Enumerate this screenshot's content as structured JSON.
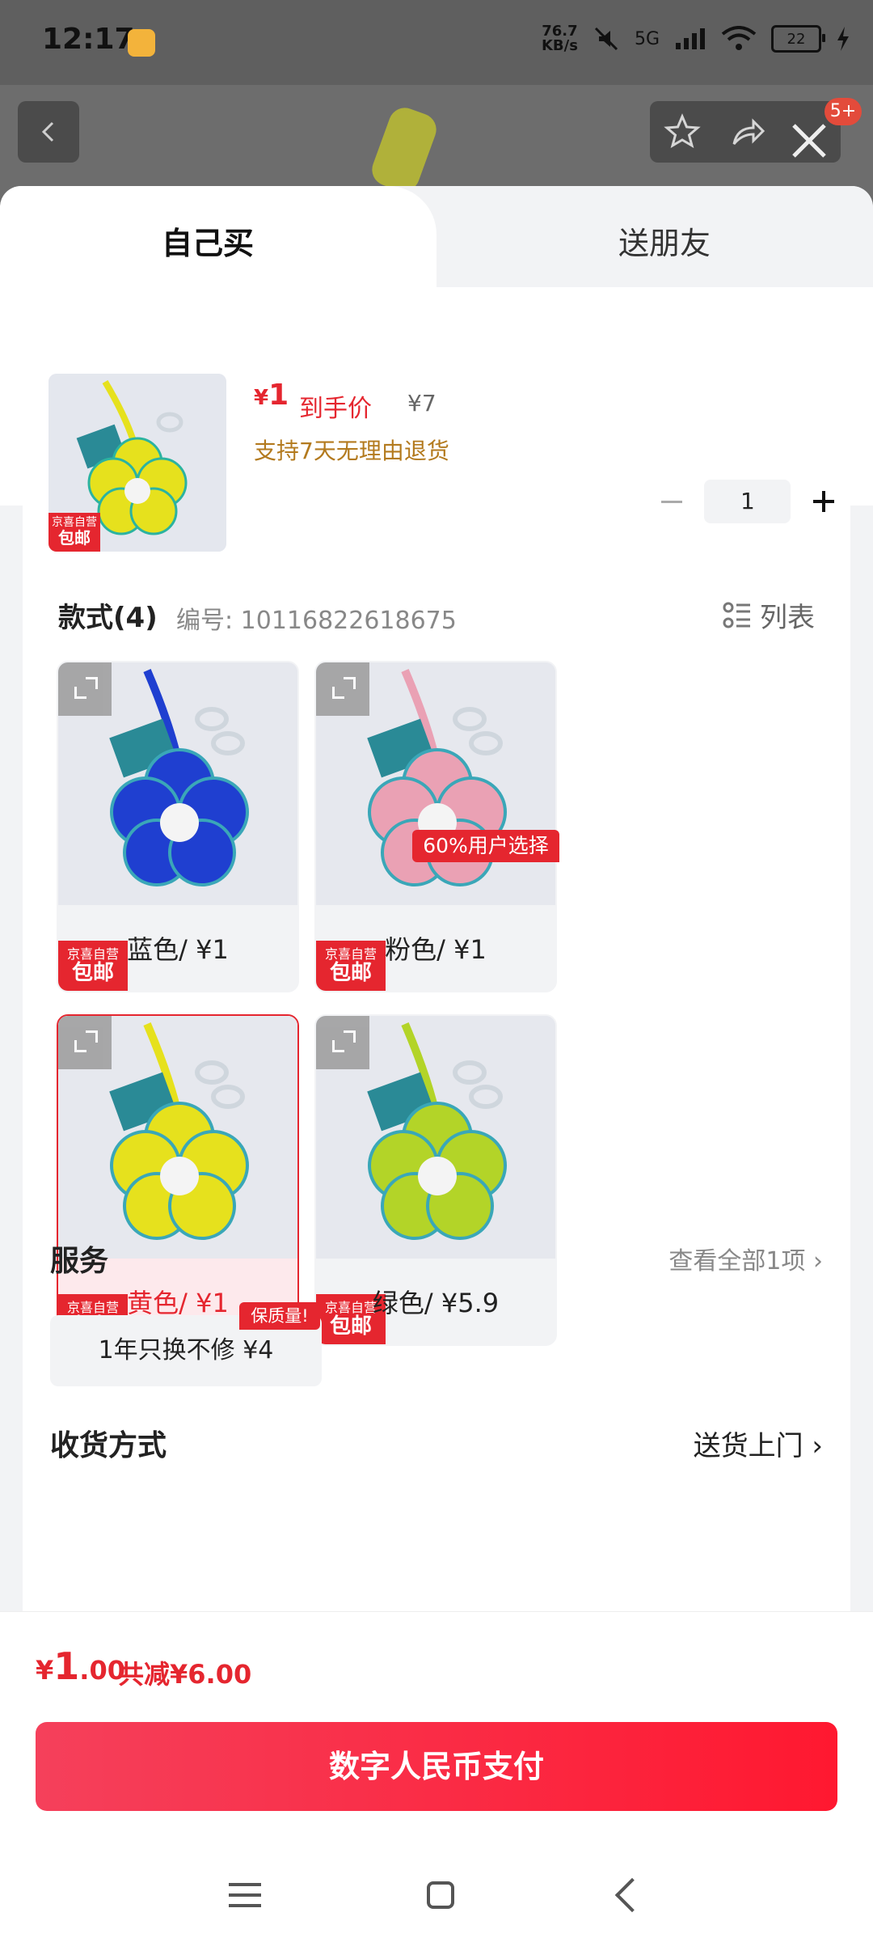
{
  "status_bar": {
    "time": "12:17",
    "net_speed": "76.7",
    "net_unit": "KB/s",
    "signal_label": "5G",
    "battery": "22"
  },
  "topbar": {
    "notif_badge": "5+"
  },
  "tabs": [
    {
      "label": "自己买",
      "active": true
    },
    {
      "label": "送朋友",
      "active": false
    }
  ],
  "product": {
    "price_symbol": "¥",
    "price": "1",
    "price_label": "到手价",
    "original_price": "¥7",
    "return_note": "支持7天无理由退货",
    "thumb_tag_top": "京喜自营",
    "thumb_tag_bottom": "包邮",
    "quantity": "1"
  },
  "styles": {
    "heading": "款式(4)",
    "code": "编号: 10116822618675",
    "list_toggle": "列表",
    "popular_badge": "60%用户选择",
    "options": [
      {
        "label": "蓝色/ ¥1",
        "tag_top": "京喜自营",
        "tag_bottom": "包邮",
        "color": "#1f3fd0",
        "selected": false
      },
      {
        "label": "粉色/ ¥1",
        "tag_top": "京喜自营",
        "tag_bottom": "包邮",
        "color": "#eaa1b4",
        "selected": false
      },
      {
        "label": "黄色/ ¥1",
        "tag_top": "京喜自营",
        "tag_bottom": "包邮",
        "color": "#e6e11d",
        "selected": true
      },
      {
        "label": "绿色/ ¥5.9",
        "tag_top": "京喜自营",
        "tag_bottom": "包邮",
        "color": "#b3d428",
        "selected": false
      }
    ]
  },
  "service": {
    "title": "服务",
    "view_all": "查看全部1项 ›",
    "chip_label": "1年只换不修  ¥4",
    "chip_badge": "保质量!"
  },
  "delivery": {
    "title": "收货方式",
    "value": "送货上门 ›"
  },
  "footer": {
    "total_yen": "¥",
    "total_big": "1",
    "total_small": ".00",
    "total_save": "共减¥6.00",
    "pay_button": "数字人民币支付"
  },
  "colors": {
    "accent": "#e5262f",
    "pay_gradient_start": "#f5405b",
    "pay_gradient_end": "#ff1830"
  }
}
